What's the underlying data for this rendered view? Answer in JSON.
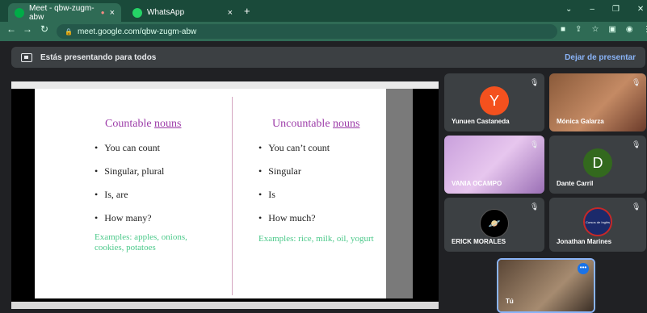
{
  "browser": {
    "tabs": [
      {
        "label": "Meet - qbw-zugm-abw",
        "active": true
      },
      {
        "label": "WhatsApp",
        "active": false
      }
    ],
    "new_tab": "+",
    "tab_close": "×",
    "recording": "●",
    "url": "meet.google.com/qbw-zugm-abw",
    "window_controls": [
      "⌄",
      "–",
      "❐",
      "✕"
    ]
  },
  "meet": {
    "presenting_text": "Estás presentando para todos",
    "stop_presenting": "Dejar de presentar"
  },
  "slide": {
    "left_heading": "Countable",
    "left_heading_u": "nouns",
    "left_bullets": [
      "You can count",
      "Singular, plural",
      "Is, are",
      "How many?"
    ],
    "left_examples": "Examples: apples, onions, cookies, potatoes",
    "right_heading": "Uncountable",
    "right_heading_u": "nouns",
    "right_bullets": [
      "You can’t count",
      "Singular",
      "Is",
      "How much?"
    ],
    "right_examples": "Examples: rice, milk, oil, yogurt"
  },
  "participants": [
    {
      "name": "Yunuen Castaneda",
      "initial": "Y",
      "color": "#f4511e"
    },
    {
      "name": "Mónica Galarza"
    },
    {
      "name": "VANIA OCAMPO"
    },
    {
      "name": "Dante Carril",
      "initial": "D",
      "color": "#33691e"
    },
    {
      "name": "ERICK MORALES"
    },
    {
      "name": "Jonathan Marines",
      "logo_text": "Cursos de Inglés"
    },
    {
      "name": "Tú"
    }
  ],
  "colors": {
    "tabbar": "#1a4a3a",
    "toolbar": "#2f6b55",
    "meet_bg": "#202124",
    "accent": "#8ab4f8"
  }
}
